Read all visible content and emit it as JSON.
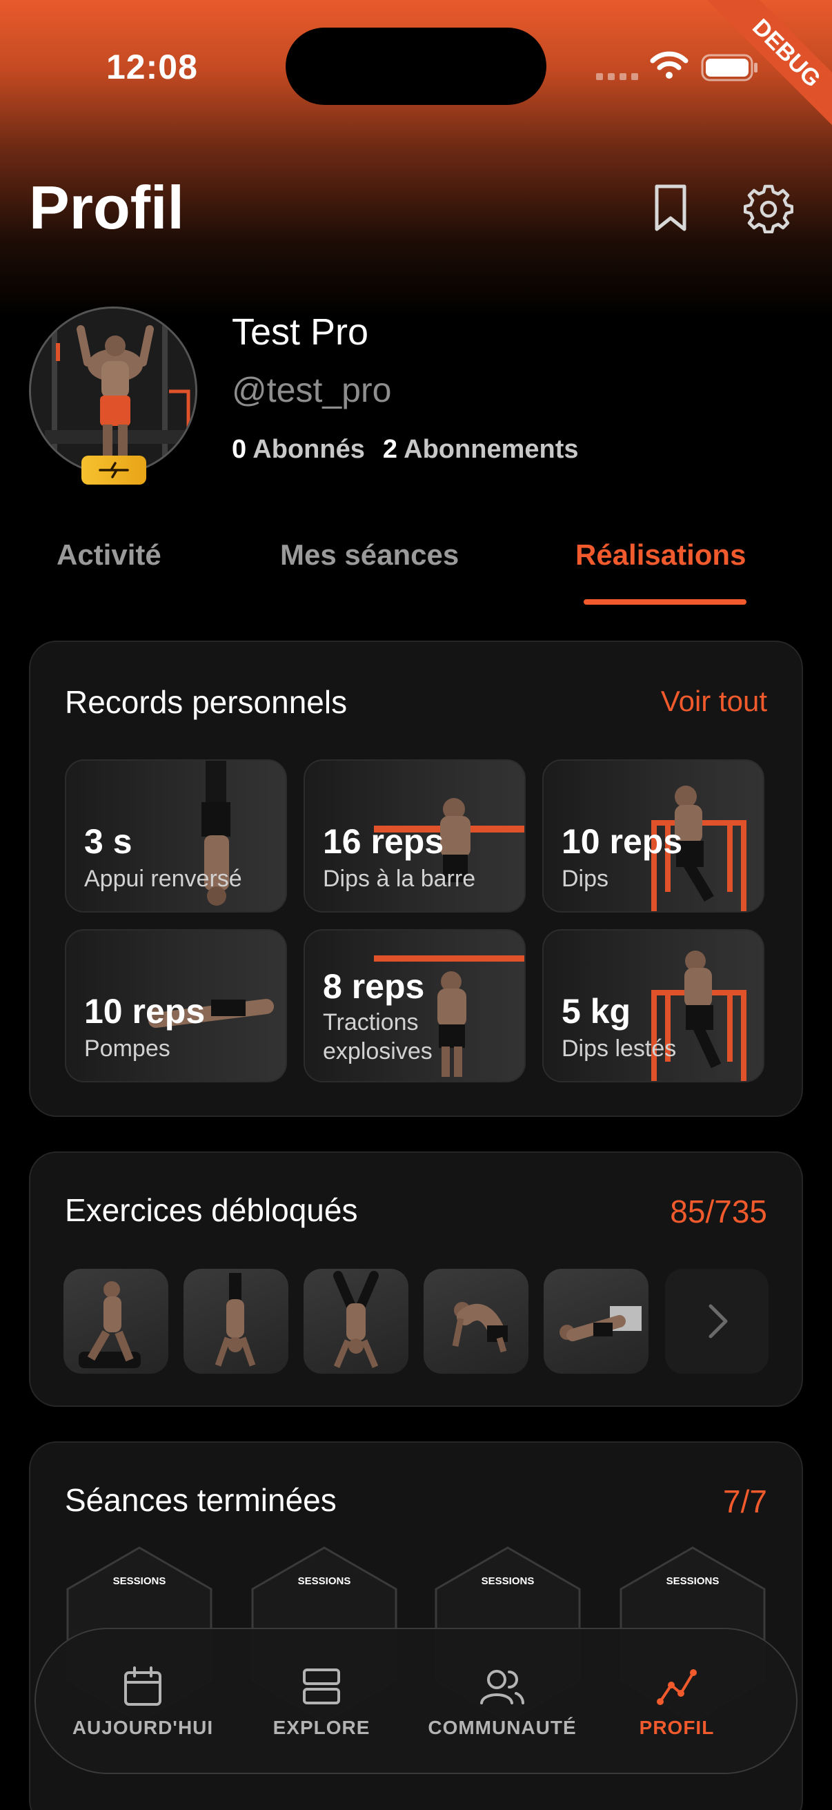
{
  "status_bar": {
    "time": "12:08"
  },
  "debug_label": "DEBUG",
  "header": {
    "title": "Profil"
  },
  "profile": {
    "name": "Test Pro",
    "handle": "@test_pro",
    "followers_count": "0",
    "followers_label": "Abonnés",
    "following_count": "2",
    "following_label": "Abonnements"
  },
  "tabs": [
    {
      "label": "Activité",
      "active": false
    },
    {
      "label": "Mes séances",
      "active": false
    },
    {
      "label": "Réalisations",
      "active": true
    }
  ],
  "records": {
    "title": "Records personnels",
    "link": "Voir tout",
    "items": [
      {
        "value": "3 s",
        "label": "Appui renversé"
      },
      {
        "value": "16 reps",
        "label": "Dips à la barre"
      },
      {
        "value": "10 reps",
        "label": "Dips"
      },
      {
        "value": "10 reps",
        "label": "Pompes"
      },
      {
        "value": "8 reps",
        "label": "Tractions explosives"
      },
      {
        "value": "5 kg",
        "label": "Dips lestés"
      }
    ]
  },
  "exercises": {
    "title": "Exercices débloqués",
    "count": "85/735"
  },
  "sessions": {
    "title": "Séances terminées",
    "count": "7/7",
    "badge_label": "SESSIONS"
  },
  "nav": [
    {
      "label": "AUJOURD'HUI",
      "icon": "calendar-icon",
      "active": false
    },
    {
      "label": "EXPLORE",
      "icon": "explore-icon",
      "active": false
    },
    {
      "label": "COMMUNAUTÉ",
      "icon": "community-icon",
      "active": false
    },
    {
      "label": "PROFIL",
      "icon": "profile-chart-icon",
      "active": true
    }
  ],
  "colors": {
    "accent": "#f05a2c",
    "card_bg": "#141414",
    "badge_gold": "#f6c12e"
  }
}
